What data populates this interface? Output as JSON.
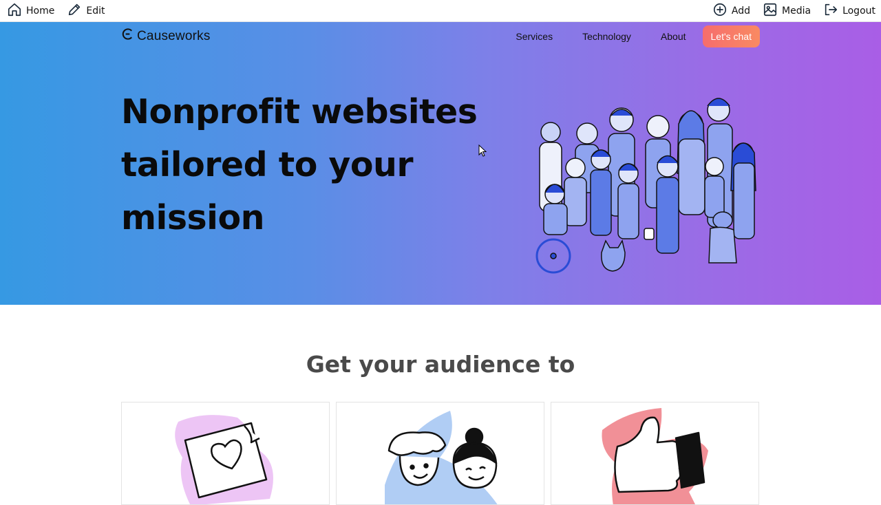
{
  "admin_bar": {
    "home_label": "Home",
    "edit_label": "Edit",
    "add_label": "Add",
    "media_label": "Media",
    "logout_label": "Logout"
  },
  "nav": {
    "brand": "Causeworks",
    "links": [
      "Services",
      "Technology",
      "About"
    ],
    "cta": "Let's chat"
  },
  "hero": {
    "title_lines": [
      "Nonprofit websites",
      "tailored to your",
      "mission"
    ]
  },
  "section": {
    "title": "Get your audience to"
  },
  "colors": {
    "gradient_start": "#3699e3",
    "gradient_end": "#a95ee6",
    "cta": "#f66d6d",
    "section_title": "#4a4a4a",
    "illustration": "#6b86e8"
  }
}
